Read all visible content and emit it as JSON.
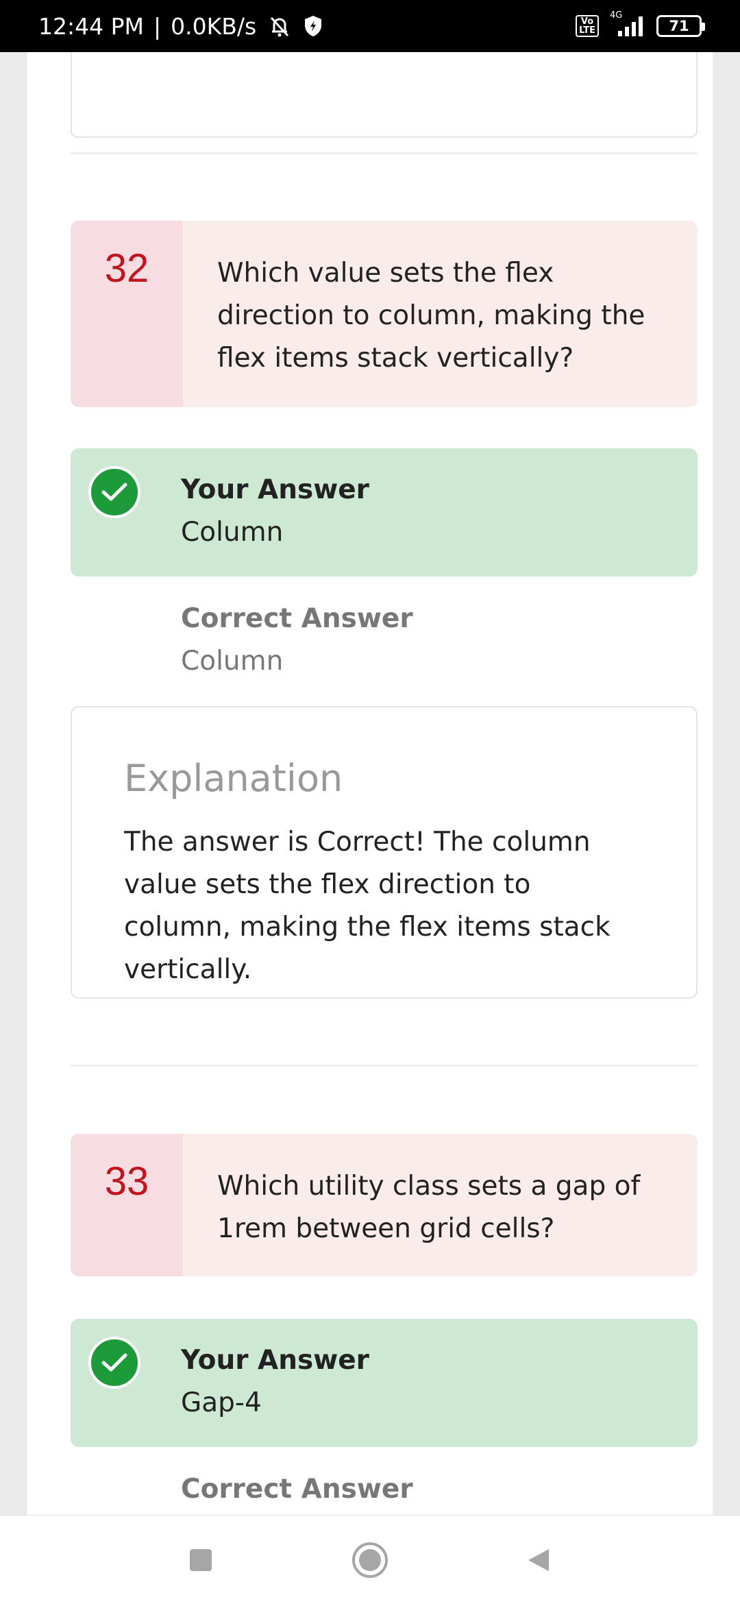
{
  "status_bar": {
    "time": "12:44 PM",
    "separator": "|",
    "net_speed": "0.0KB/s",
    "battery": "71",
    "network_type": "4G",
    "volte_line1": "Vo",
    "volte_line2": "LTE"
  },
  "questions": [
    {
      "number": "32",
      "text": "Which value sets the flex direction to column, making the flex items stack vertically?",
      "your_answer_label": "Your Answer",
      "your_answer": "Column",
      "correct_answer_label": "Correct Answer",
      "correct_answer": "Column",
      "explanation_title": "Explanation",
      "explanation": "The answer is Correct! The column value sets the flex direction to column, making the flex items stack vertically."
    },
    {
      "number": "33",
      "text": "Which utility class sets a gap of 1rem between grid cells?",
      "your_answer_label": "Your Answer",
      "your_answer": "Gap-4",
      "correct_answer_label": "Correct Answer"
    }
  ],
  "colors": {
    "question_bg": "#fbecec",
    "question_number_bg": "#f7dde1",
    "question_number": "#c0141e",
    "answer_bg": "#cde9d3",
    "check": "#1d9a3a"
  },
  "nav_bar": {
    "recents_icon": "square-icon",
    "home_icon": "circle-icon",
    "back_icon": "triangle-back-icon"
  }
}
